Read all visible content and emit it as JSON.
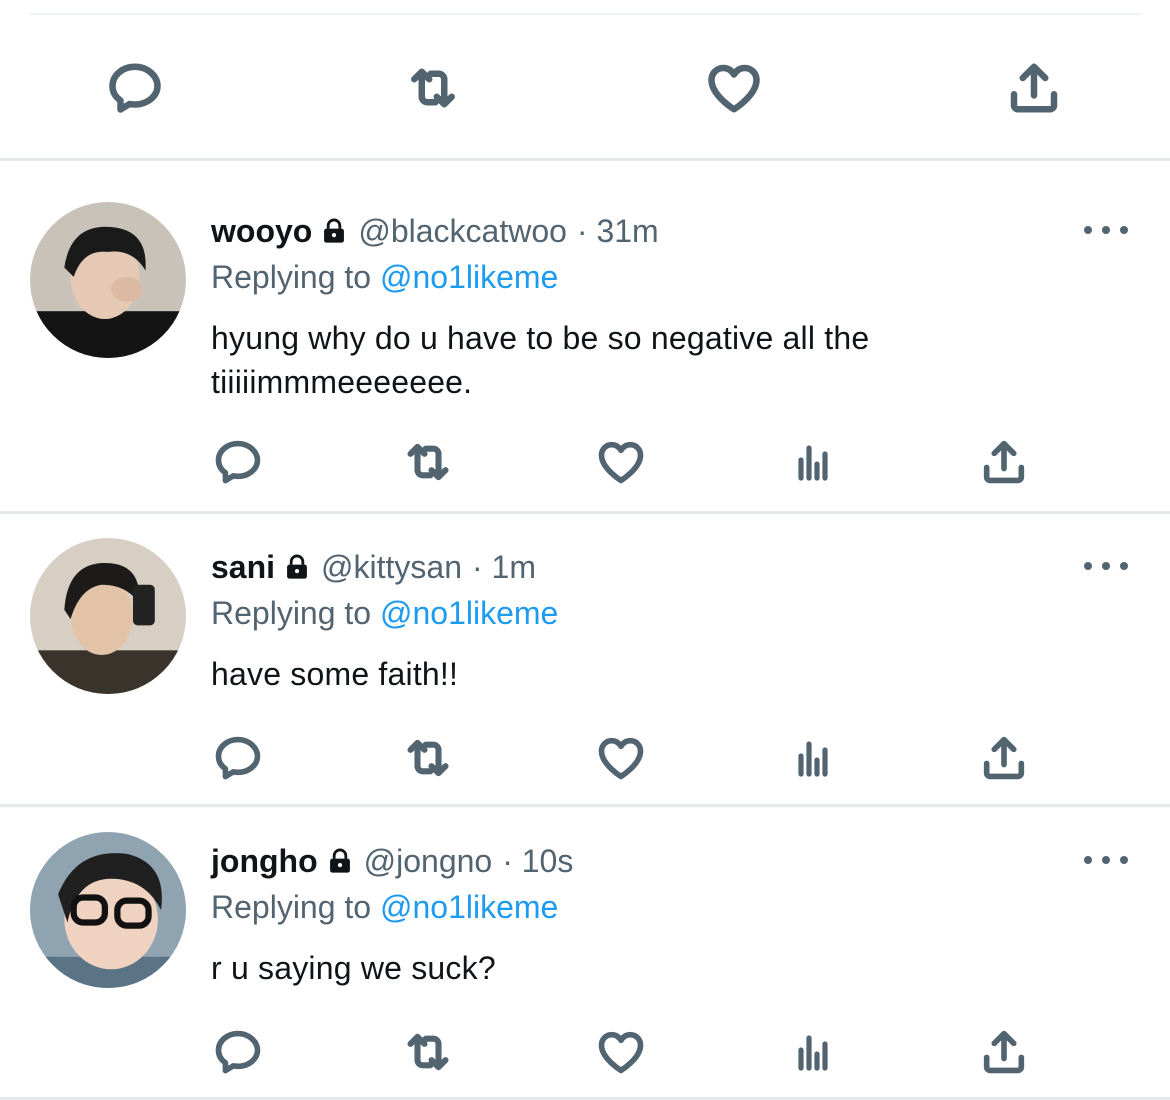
{
  "tweets": [
    {
      "display_name": "wooyo",
      "handle": "@blackcatwoo",
      "time": "· 31m",
      "replying_prefix": "Replying to",
      "replying_to": "@no1likeme",
      "text": "hyung why do u have to be so negative all the tiiiiimmmeeeeeee.",
      "avatar_colors": {
        "bg": "#c9c2b8",
        "hair": "#1a1a1a",
        "skin": "#e6c9b4",
        "shirt": "#141414"
      }
    },
    {
      "display_name": "sani",
      "handle": "@kittysan",
      "time": "· 1m",
      "replying_prefix": "Replying to",
      "replying_to": "@no1likeme",
      "text": "have some faith!!",
      "avatar_colors": {
        "bg": "#d8cfc4",
        "hair": "#1d1b1a",
        "skin": "#e3c3a8",
        "shirt": "#3a332c"
      }
    },
    {
      "display_name": "jongho",
      "handle": "@jongno",
      "time": "· 10s",
      "replying_prefix": "Replying to",
      "replying_to": "@no1likeme",
      "text": "r u saying we suck?",
      "avatar_colors": {
        "bg": "#8fa3b0",
        "hair": "#202020",
        "skin": "#f0d2c0",
        "shirt": "#5b7485"
      }
    }
  ],
  "icons": {
    "reply": "reply-icon",
    "retweet": "retweet-icon",
    "like": "heart-icon",
    "analytics": "analytics-icon",
    "share": "share-icon",
    "more": "more-icon",
    "lock": "lock-icon"
  },
  "colors": {
    "accent": "#1d9bf0",
    "secondary_text": "#536471",
    "primary_text": "#0f1419",
    "divider": "#e6e9eb"
  }
}
